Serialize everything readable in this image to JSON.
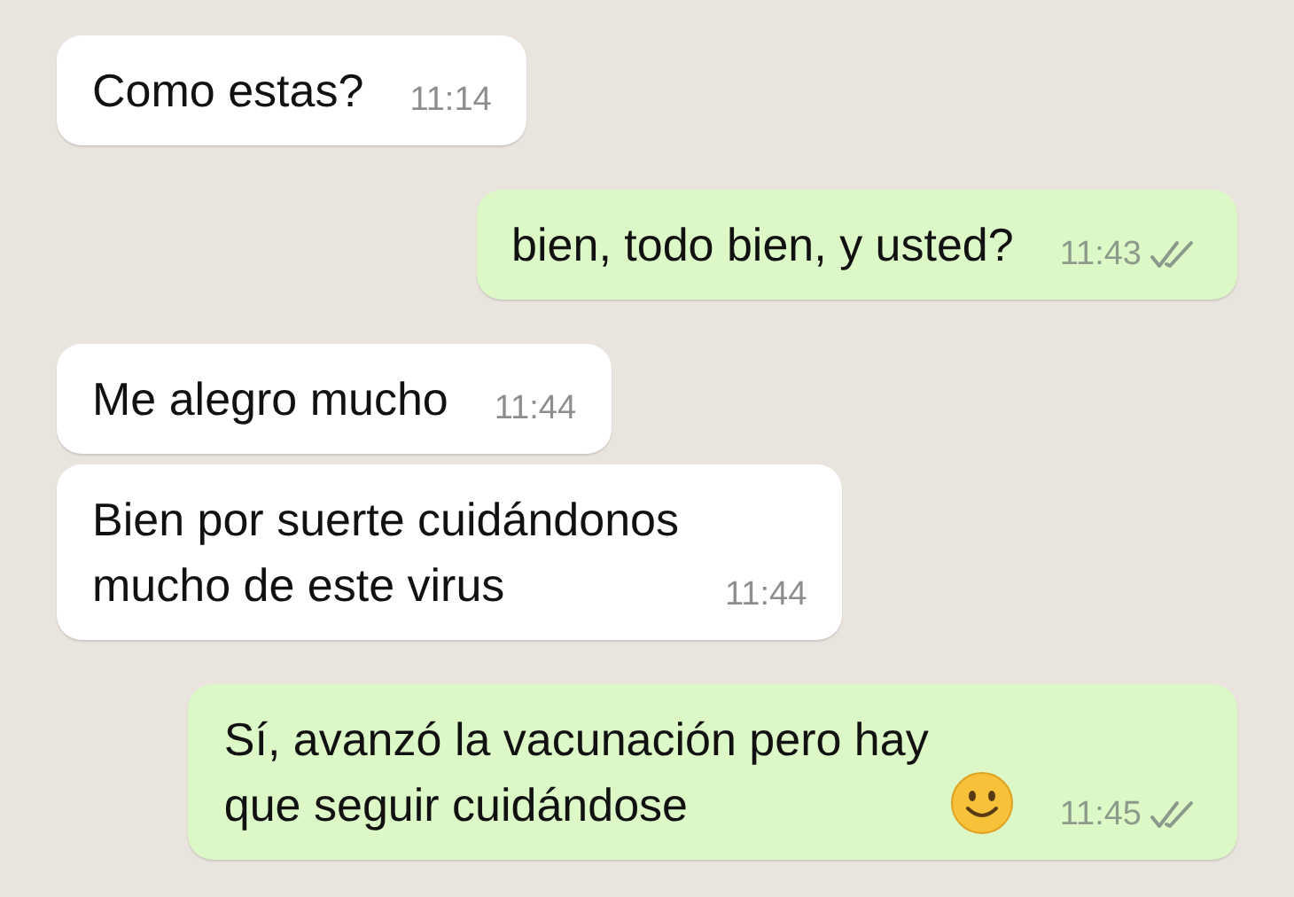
{
  "messages": [
    {
      "outgoing": false,
      "text": "Como estas?",
      "time": "11:14",
      "emoji": false
    },
    {
      "outgoing": true,
      "text": "bien, todo bien, y usted?",
      "time": "11:43",
      "read": false,
      "emoji": false
    },
    {
      "outgoing": false,
      "text": "Me alegro mucho",
      "time": "11:44",
      "emoji": false
    },
    {
      "outgoing": false,
      "text": "Bien por suerte cuidándonos\nmucho de este virus",
      "time": "11:44",
      "emoji": false
    },
    {
      "outgoing": true,
      "text": "Sí, avanzó la vacunación pero hay\nque seguir cuidándose",
      "time": "11:45",
      "read": false,
      "emoji": true
    }
  ]
}
